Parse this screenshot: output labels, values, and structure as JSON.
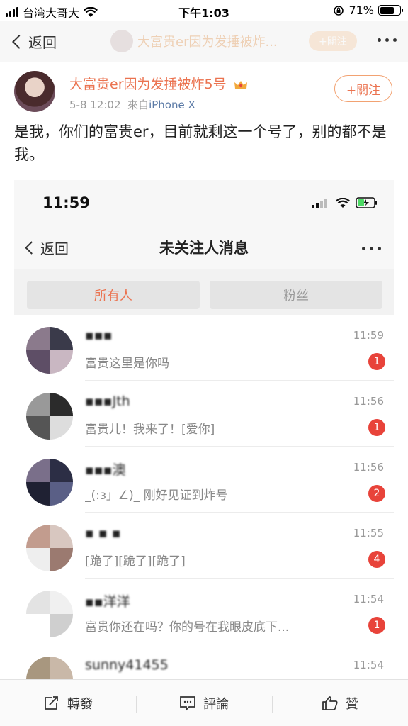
{
  "status_bar": {
    "carrier": "台湾大哥大",
    "time": "下午1:03",
    "battery": "71%",
    "battery_level": 0.71
  },
  "nav": {
    "back_label": "返回",
    "title": "大富贵er因为发捶被炸...",
    "follow_label": "+關注"
  },
  "post": {
    "author": "大富贵er因为发捶被炸5号",
    "date": "5-8 12:02",
    "source_prefix": "來自",
    "source": "iPhone X",
    "follow_label": "+關注",
    "text": "是我，你们的富贵er，目前就剩这一个号了，别的都不是我。"
  },
  "screenshot": {
    "time": "11:59",
    "back_label": "返回",
    "title": "未关注人消息",
    "tabs": [
      {
        "label": "所有人",
        "active": true
      },
      {
        "label": "粉丝",
        "active": false
      }
    ],
    "messages": [
      {
        "name": "▪▪▪",
        "message": "富贵这里是你吗",
        "time": "11:59",
        "badge": "1"
      },
      {
        "name": "▪▪▪Jth",
        "message": "富贵儿！我来了！[爱你]",
        "time": "11:56",
        "badge": "1"
      },
      {
        "name": "▪▪▪澳",
        "message": "_(:з」∠)_ 刚好见证到炸号",
        "time": "11:56",
        "badge": "2"
      },
      {
        "name": "▪ ▪ ▪",
        "message": "[跪了][跪了][跪了]",
        "time": "11:55",
        "badge": "4"
      },
      {
        "name": "▪▪洋洋",
        "message": "富贵你还在吗？你的号在我眼皮底下...",
        "time": "11:54",
        "badge": "1"
      },
      {
        "name": "sunny41455",
        "message": "",
        "time": "11:54",
        "badge": ""
      }
    ]
  },
  "toolbar": {
    "repost_label": "轉發",
    "comment_label": "評論",
    "like_label": "贊"
  },
  "colors": {
    "accent": "#eb7350",
    "badge": "#e8433a",
    "link": "#5b7aa6"
  }
}
